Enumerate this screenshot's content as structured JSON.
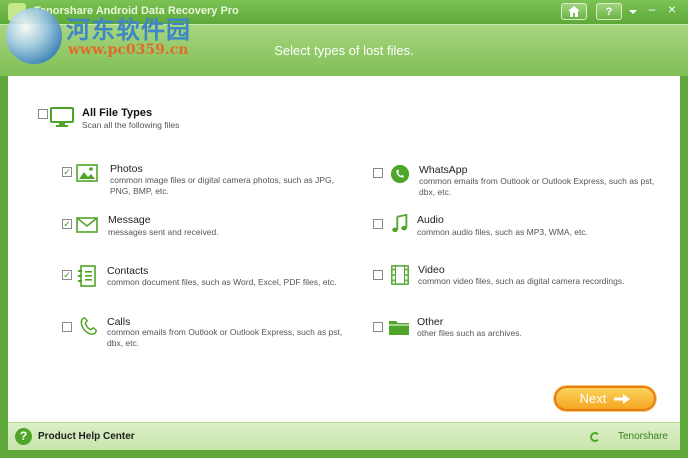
{
  "window": {
    "title": "Tenorshare Android Data Recovery Pro",
    "home_icon": "home-icon",
    "help_label": "?",
    "menu_icon": "chevron-down-icon",
    "minimize_label": "–",
    "close_label": "×"
  },
  "watermark": {
    "name": "河东软件园",
    "url": "www.pc0359.cn"
  },
  "banner": {
    "title": "Select types of lost files."
  },
  "all_types": {
    "label": "All File Types",
    "description": "Scan all the following files",
    "checked": false
  },
  "items": [
    {
      "title": "Photos",
      "description": "common image files or digital camera photos, such as JPG, PNG, BMP, etc.",
      "checked": true,
      "icon": "photo-icon"
    },
    {
      "title": "WhatsApp",
      "description": "common emails from Outlook or Outlook Express, such as pst, dbx, etc.",
      "checked": false,
      "icon": "whatsapp-icon"
    },
    {
      "title": "Message",
      "description": "messages sent and received.",
      "checked": true,
      "icon": "envelope-icon"
    },
    {
      "title": "Audio",
      "description": "common audio files, such as MP3, WMA, etc.",
      "checked": false,
      "icon": "music-note-icon"
    },
    {
      "title": "Contacts",
      "description": "common document files, such as Word, Excel, PDF files, etc.",
      "checked": true,
      "icon": "contacts-icon"
    },
    {
      "title": "Video",
      "description": "common video files, such as digital camera recordings.",
      "checked": false,
      "icon": "film-icon"
    },
    {
      "title": "Calls",
      "description": "common emails from Outlook or Outlook Express, such as pst, dbx, etc.",
      "checked": false,
      "icon": "phone-icon"
    },
    {
      "title": "Other",
      "description": "other files such as archives.",
      "checked": false,
      "icon": "folder-icon"
    }
  ],
  "next_button": {
    "label": "Next",
    "icon": "arrow-right-icon"
  },
  "footer": {
    "help_label": "Product Help Center",
    "brand": "Tenorshare"
  },
  "colors": {
    "accent_green": "#5fa83c",
    "icon_green": "#4fa52a",
    "next_orange": "#f5a623"
  }
}
